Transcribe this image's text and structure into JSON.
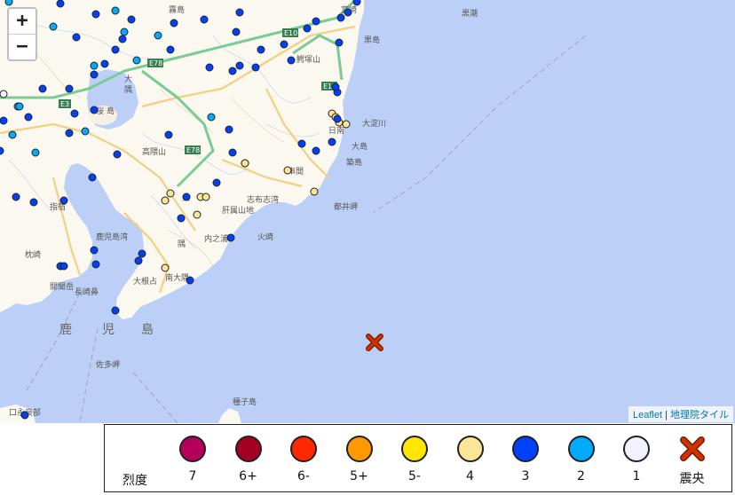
{
  "map": {
    "zoom_in": "+",
    "zoom_out": "−",
    "attribution_leaflet": "Leaflet",
    "attribution_sep": "|",
    "attribution_tiles": "地理院タイル",
    "place_labels": [
      "鹿",
      "児",
      "島",
      "大",
      "隅",
      "桜",
      "島",
      "高隈山",
      "大",
      "隅",
      "肝属山地",
      "志布志湾",
      "都井岬",
      "鹿児島湾",
      "佐多岬",
      "串間",
      "日南",
      "鰐塚山",
      "大淀川",
      "大島",
      "築島",
      "黒島",
      "火崎",
      "内之浦",
      "大根占",
      "南大隅",
      "開聞岳",
      "長崎鼻",
      "指宿",
      "枕崎",
      "口永良部",
      "種子島",
      "黒潮",
      "霧島",
      "宮崎"
    ],
    "road_labels": [
      "E10",
      "E78",
      "E3",
      "E78",
      "E10"
    ]
  },
  "legend": {
    "title": "烈度",
    "items": [
      {
        "label": "7",
        "color": "#b4005b"
      },
      {
        "label": "6+",
        "color": "#a50021"
      },
      {
        "label": "6-",
        "color": "#ff2800"
      },
      {
        "label": "5+",
        "color": "#ff9900"
      },
      {
        "label": "5-",
        "color": "#ffe600"
      },
      {
        "label": "4",
        "color": "#fae696"
      },
      {
        "label": "3",
        "color": "#0041ff"
      },
      {
        "label": "2",
        "color": "#00aaff"
      },
      {
        "label": "1",
        "color": "#f2f2ff"
      },
      {
        "label": "震央",
        "color": "#cc3300"
      }
    ]
  },
  "stations": {
    "colors": {
      "i4": "#fae696",
      "i3": "#0041ff",
      "i2": "#00aaff",
      "i1": "#f2f2ff"
    }
  },
  "epicenter": {
    "color": "#cc3300"
  }
}
